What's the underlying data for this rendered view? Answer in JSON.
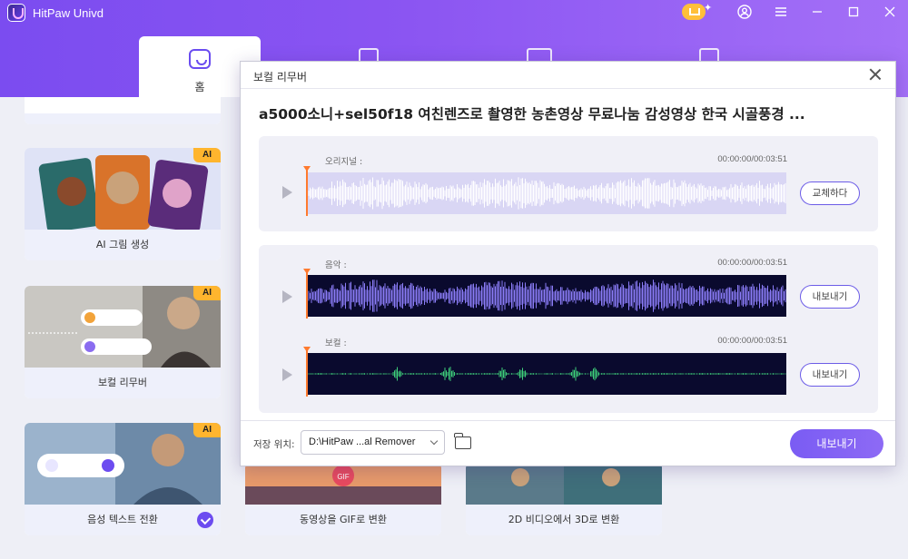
{
  "app": {
    "title": "HitPaw Univd"
  },
  "window_controls": [
    "cart-icon",
    "account-icon",
    "menu-icon",
    "minimize-icon",
    "maximize-icon",
    "close-icon"
  ],
  "tabs": {
    "home_label": "홈"
  },
  "cards": [
    {
      "label": "AI 그림 생성",
      "badge": "AI"
    },
    {
      "label": "보컬 리무버",
      "badge": "AI"
    },
    {
      "label": "음성 텍스트 전환",
      "badge": "AI"
    },
    {
      "label": "동영상을 GIF로 변환",
      "badge": "GIF"
    },
    {
      "label": "2D 비디오에서 3D로 변환"
    }
  ],
  "modal": {
    "title": "보컬 리무버",
    "song_title": "a5000소니+sel50f18 여친렌즈로 촬영한 농촌영상 무료나눔 감성영상 한국 시골풍경 ...",
    "original": {
      "label": "오리지널 :",
      "time": "00:00:00/00:03:51",
      "button": "교체하다"
    },
    "music": {
      "label": "음악 :",
      "time": "00:00:00/00:03:51",
      "button": "내보내기"
    },
    "vocal": {
      "label": "보컬 :",
      "time": "00:00:00/00:03:51",
      "button": "내보내기"
    },
    "footer": {
      "save_label": "저장 위치:",
      "path": "D:\\HitPaw ...al Remover",
      "export": "내보내기"
    }
  },
  "colors": {
    "accent": "#7b5cf3",
    "playhead": "#ff7a2e",
    "music_wave": "#8b7cf7",
    "vocal_wave": "#3ecf7a"
  }
}
